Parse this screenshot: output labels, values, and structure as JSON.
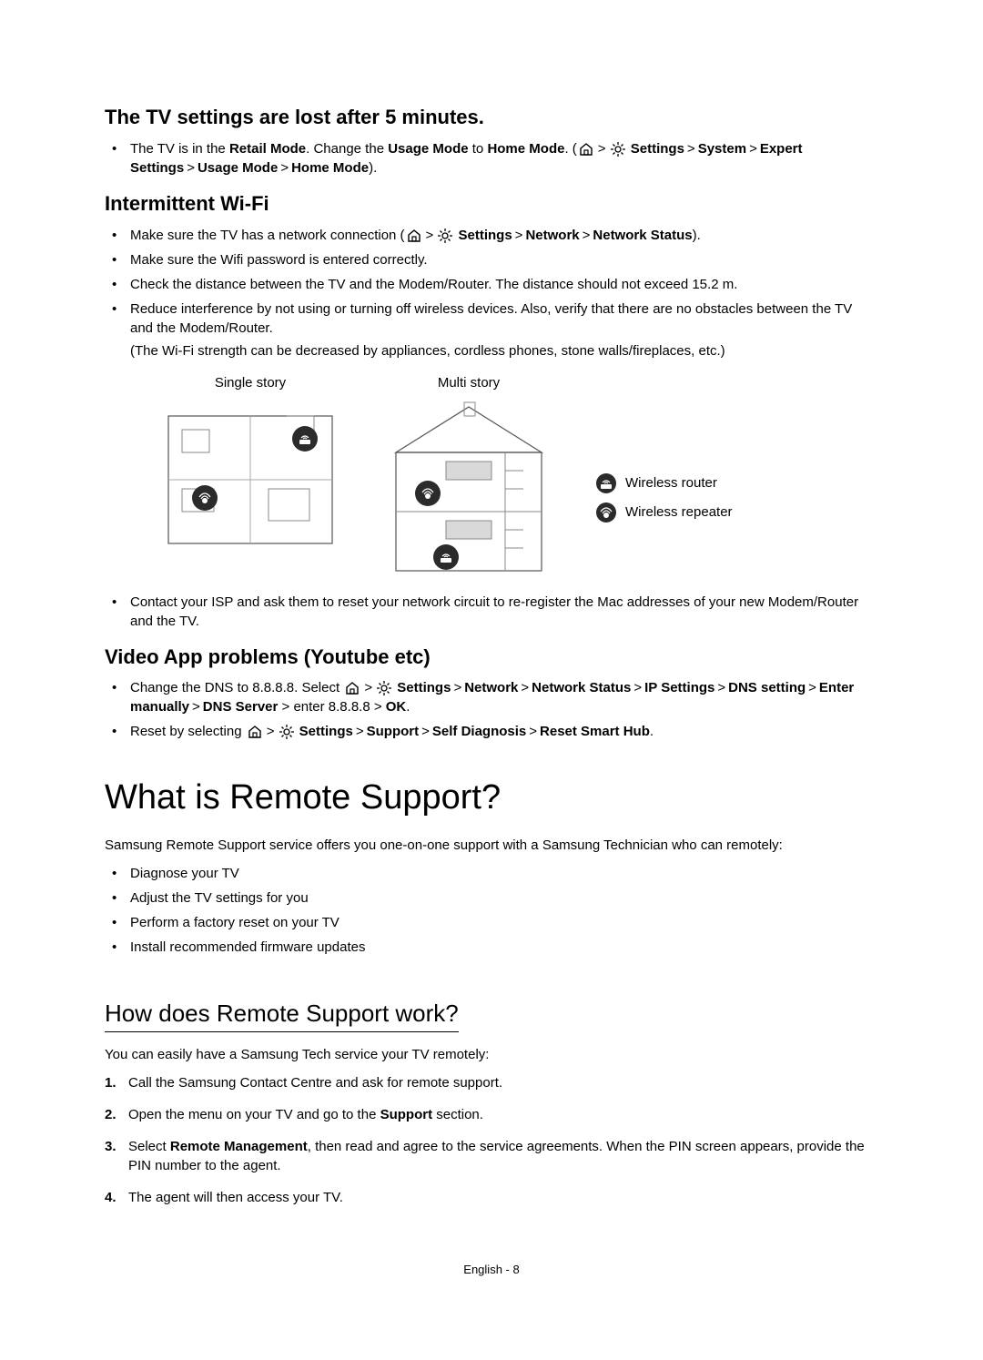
{
  "section1": {
    "heading": "The TV settings are lost after 5 minutes.",
    "bullets": [
      {
        "pre": "The TV is in the ",
        "b1": "Retail Mode",
        "mid1": ". Change the ",
        "b2": "Usage Mode",
        "mid2": " to ",
        "b3": "Home Mode",
        "mid3": ". (",
        "path": [
          "Settings",
          "System",
          "Expert Settings",
          "Usage Mode",
          "Home Mode"
        ],
        "post": ")."
      }
    ]
  },
  "section2": {
    "heading": "Intermittent Wi-Fi",
    "b1": {
      "pre": "Make sure the TV has a network connection (",
      "path": [
        "Settings",
        "Network",
        "Network Status"
      ],
      "post": ")."
    },
    "b2": "Make sure the Wifi password is entered correctly.",
    "b3": "Check the distance between the TV and the Modem/Router. The distance should not exceed 15.2 m.",
    "b4": "Reduce interference by not using or turning off wireless devices. Also, verify that there are no obstacles between the TV and the Modem/Router.",
    "b4note": "(The Wi-Fi strength can be decreased by appliances, cordless phones, stone walls/fireplaces, etc.)",
    "dia1": "Single story",
    "dia2": "Multi story",
    "legend1": "Wireless router",
    "legend2": "Wireless repeater",
    "b5": "Contact your ISP and ask them to reset your network circuit to re-register the Mac addresses of your new Modem/Router and the TV."
  },
  "section3": {
    "heading": "Video App problems (Youtube etc)",
    "b1": {
      "pre": "Change the DNS to 8.8.8.8. Select ",
      "path": [
        "Settings",
        "Network",
        "Network Status",
        "IP Settings",
        "DNS setting",
        "Enter manually",
        "DNS Server"
      ],
      "mid": " > enter 8.8.8.8 > ",
      "last": "OK",
      "post": "."
    },
    "b2": {
      "pre": "Reset by selecting ",
      "path": [
        "Settings",
        "Support",
        "Self Diagnosis",
        "Reset Smart Hub"
      ],
      "post": "."
    }
  },
  "remote": {
    "title": "What is Remote Support?",
    "intro": "Samsung Remote Support service offers you one-on-one support with a Samsung Technician who can remotely:",
    "bullets": [
      "Diagnose your TV",
      "Adjust the TV settings for you",
      "Perform a factory reset on your TV",
      "Install recommended firmware updates"
    ]
  },
  "how": {
    "title": "How does Remote Support work?",
    "intro": "You can easily have a Samsung Tech service your TV remotely:",
    "steps": {
      "s1": "Call the Samsung Contact Centre and ask for remote support.",
      "s2pre": "Open the menu on your TV and go to the ",
      "s2b": "Support",
      "s2post": " section.",
      "s3pre": "Select ",
      "s3b": "Remote Management",
      "s3post": ", then read and agree to the service agreements. When the PIN screen appears, provide the PIN number to the agent.",
      "s4": "The agent will then access your TV."
    }
  },
  "footer": "English - 8"
}
